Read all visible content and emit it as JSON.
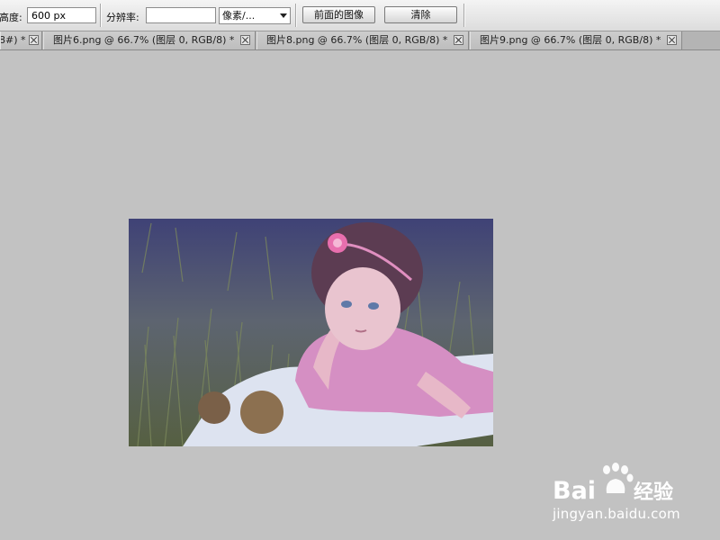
{
  "options_bar": {
    "height_label": "高度:",
    "height_value": "600 px",
    "resolution_label": "分辨率:",
    "resolution_value": "",
    "unit_select": "像素/...",
    "front_image_button": "前面的图像",
    "clear_button": "清除"
  },
  "tabs": [
    {
      "label": "8#) *"
    },
    {
      "label": "图片6.png @ 66.7% (图层 0, RGB/8) *"
    },
    {
      "label": "图片8.png @ 66.7% (图层 0, RGB/8) *"
    },
    {
      "label": "图片9.png @ 66.7% (图层 0, RGB/8) *"
    }
  ],
  "watermark": {
    "logo_text": "Baidu经验",
    "url": "jingyan.baidu.com"
  },
  "colors": {
    "workspace": "#c2c2c2",
    "photo_tint": "#4c5078"
  }
}
